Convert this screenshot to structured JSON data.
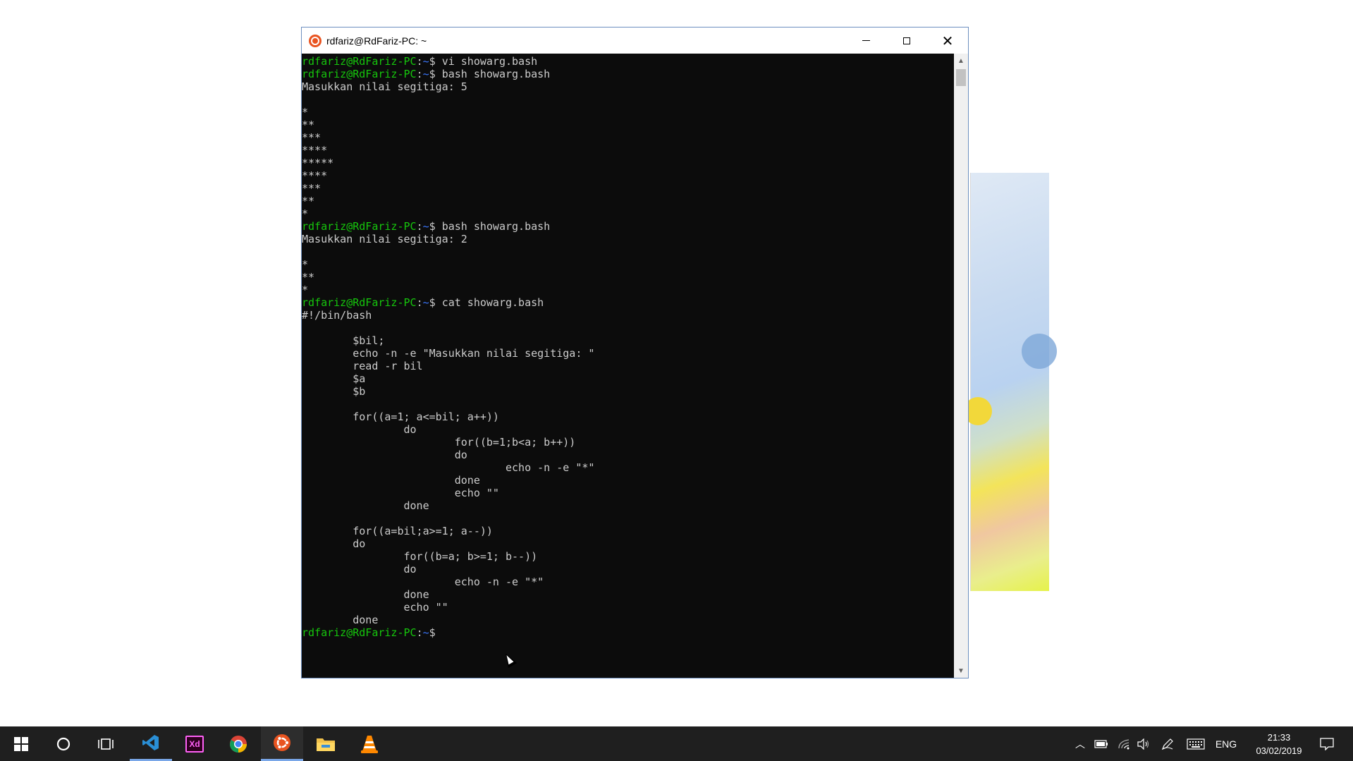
{
  "window": {
    "title": "rdfariz@RdFariz-PC: ~",
    "app_icon": "ubuntu-icon",
    "controls": [
      "minimize-icon",
      "maximize-icon",
      "close-icon"
    ]
  },
  "terminal": {
    "prompt_user": "rdfariz@RdFariz-PC",
    "prompt_path": "~",
    "lines": [
      {
        "type": "cmd",
        "text": "vi showarg.bash"
      },
      {
        "type": "cmd",
        "text": "bash showarg.bash"
      },
      {
        "type": "out",
        "text": "Masukkan nilai segitiga: 5"
      },
      {
        "type": "out",
        "text": ""
      },
      {
        "type": "out",
        "text": "*"
      },
      {
        "type": "out",
        "text": "**"
      },
      {
        "type": "out",
        "text": "***"
      },
      {
        "type": "out",
        "text": "****"
      },
      {
        "type": "out",
        "text": "*****"
      },
      {
        "type": "out",
        "text": "****"
      },
      {
        "type": "out",
        "text": "***"
      },
      {
        "type": "out",
        "text": "**"
      },
      {
        "type": "out",
        "text": "*"
      },
      {
        "type": "cmd",
        "text": "bash showarg.bash"
      },
      {
        "type": "out",
        "text": "Masukkan nilai segitiga: 2"
      },
      {
        "type": "out",
        "text": ""
      },
      {
        "type": "out",
        "text": "*"
      },
      {
        "type": "out",
        "text": "**"
      },
      {
        "type": "out",
        "text": "*"
      },
      {
        "type": "cmd",
        "text": "cat showarg.bash"
      },
      {
        "type": "out",
        "text": "#!/bin/bash"
      },
      {
        "type": "out",
        "text": ""
      },
      {
        "type": "out",
        "text": "        $bil;"
      },
      {
        "type": "out",
        "text": "        echo -n -e \"Masukkan nilai segitiga: \""
      },
      {
        "type": "out",
        "text": "        read -r bil"
      },
      {
        "type": "out",
        "text": "        $a"
      },
      {
        "type": "out",
        "text": "        $b"
      },
      {
        "type": "out",
        "text": ""
      },
      {
        "type": "out",
        "text": "        for((a=1; a<=bil; a++))"
      },
      {
        "type": "out",
        "text": "                do"
      },
      {
        "type": "out",
        "text": "                        for((b=1;b<a; b++))"
      },
      {
        "type": "out",
        "text": "                        do"
      },
      {
        "type": "out",
        "text": "                                echo -n -e \"*\""
      },
      {
        "type": "out",
        "text": "                        done"
      },
      {
        "type": "out",
        "text": "                        echo \"\""
      },
      {
        "type": "out",
        "text": "                done"
      },
      {
        "type": "out",
        "text": ""
      },
      {
        "type": "out",
        "text": "        for((a=bil;a>=1; a--))"
      },
      {
        "type": "out",
        "text": "        do"
      },
      {
        "type": "out",
        "text": "                for((b=a; b>=1; b--))"
      },
      {
        "type": "out",
        "text": "                do"
      },
      {
        "type": "out",
        "text": "                        echo -n -e \"*\""
      },
      {
        "type": "out",
        "text": "                done"
      },
      {
        "type": "out",
        "text": "                echo \"\""
      },
      {
        "type": "out",
        "text": "        done"
      },
      {
        "type": "cmd",
        "text": ""
      }
    ]
  },
  "taskbar": {
    "items": [
      {
        "name": "start-button",
        "icon": "windows-icon"
      },
      {
        "name": "search-button",
        "icon": "cortana-circle-icon"
      },
      {
        "name": "task-view-button",
        "icon": "task-view-icon"
      },
      {
        "name": "taskbar-vscode",
        "icon": "vscode-icon",
        "state": "running"
      },
      {
        "name": "taskbar-adobe-xd",
        "icon": "adobe-xd-icon",
        "label": "Xd"
      },
      {
        "name": "taskbar-chrome",
        "icon": "chrome-icon"
      },
      {
        "name": "taskbar-ubuntu",
        "icon": "ubuntu-icon",
        "state": "active"
      },
      {
        "name": "taskbar-file-explorer",
        "icon": "folder-icon"
      },
      {
        "name": "taskbar-vlc",
        "icon": "vlc-cone-icon"
      }
    ],
    "tray": {
      "icons": [
        "chevron-up-icon",
        "battery-icon",
        "wifi-icon",
        "volume-icon",
        "pen-icon",
        "keyboard-icon"
      ],
      "language": "ENG",
      "time": "21:33",
      "date": "03/02/2019",
      "notification_icon": "action-center-icon"
    }
  }
}
